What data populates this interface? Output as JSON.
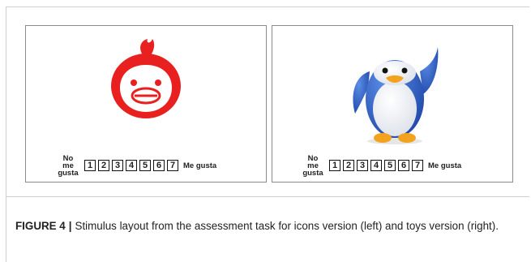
{
  "panels": [
    {
      "id": "icons",
      "image": "penguin-icon-red",
      "scale": {
        "low_label_line1": "No me",
        "low_label_line2": "gusta",
        "points": [
          "1",
          "2",
          "3",
          "4",
          "5",
          "6",
          "7"
        ],
        "high_label": "Me gusta"
      }
    },
    {
      "id": "toys",
      "image": "penguin-toy-blue",
      "scale": {
        "low_label_line1": "No me",
        "low_label_line2": "gusta",
        "points": [
          "1",
          "2",
          "3",
          "4",
          "5",
          "6",
          "7"
        ],
        "high_label": "Me gusta"
      }
    }
  ],
  "caption": {
    "label": "FIGURE 4",
    "separator": "|",
    "text": "Stimulus layout from the assessment task for icons version (left) and toys version (right)."
  },
  "colors": {
    "icon_red": "#e8201f",
    "toy_blue": "#2f5fc6",
    "beak_orange": "#f2a21c"
  }
}
